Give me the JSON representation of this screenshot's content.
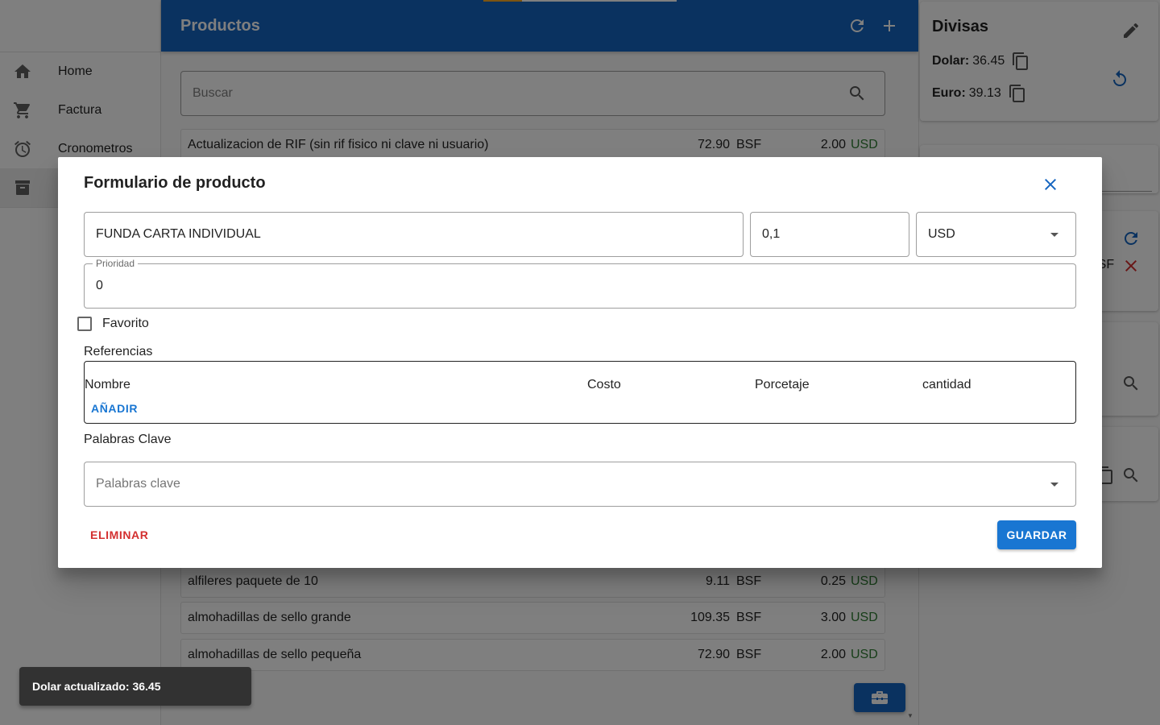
{
  "sidebar": {
    "items": [
      {
        "label": "Home",
        "icon": "home-icon"
      },
      {
        "label": "Factura",
        "icon": "cart-icon"
      },
      {
        "label": "Cronometros",
        "icon": "alarm-icon"
      },
      {
        "label": "",
        "icon": "archive-icon"
      }
    ]
  },
  "appbar": {
    "title": "Productos",
    "icons": [
      "refresh-icon",
      "add-icon"
    ]
  },
  "search": {
    "placeholder": "Buscar"
  },
  "products": [
    {
      "name": "Actualizacion de RIF (sin rif fisico ni clave ni usuario)",
      "bsf": "72.90",
      "bsf_cur": "BSF",
      "usd": "2.00",
      "usd_cur": "USD"
    },
    {
      "name": "alfileres paquete de 10",
      "bsf": "9.11",
      "bsf_cur": "BSF",
      "usd": "0.25",
      "usd_cur": "USD"
    },
    {
      "name": "almohadillas de sello grande",
      "bsf": "109.35",
      "bsf_cur": "BSF",
      "usd": "3.00",
      "usd_cur": "USD"
    },
    {
      "name": "almohadillas de sello pequeña",
      "bsf": "72.90",
      "bsf_cur": "BSF",
      "usd": "2.00",
      "usd_cur": "USD"
    }
  ],
  "divisas": {
    "title": "Divisas",
    "dolar_label": "Dolar:",
    "dolar_value": "36.45",
    "euro_label": "Euro:",
    "euro_value": "39.13"
  },
  "right_partial": {
    "bsf_fragment": "BSF"
  },
  "dialog": {
    "title": "Formulario de producto",
    "name_value": "FUNDA CARTA INDIVIDUAL",
    "price_value": "0,1",
    "currency_value": "USD",
    "priority_label": "Prioridad",
    "priority_value": "0",
    "favorite_label": "Favorito",
    "favorite_checked": false,
    "references_label": "Referencias",
    "ref_columns": [
      "Nombre",
      "Costo",
      "Porcetaje",
      "cantidad"
    ],
    "add_label": "AÑADIR",
    "keywords_label": "Palabras Clave",
    "keywords_placeholder": "Palabras clave",
    "delete_label": "ELIMINAR",
    "save_label": "GUARDAR"
  },
  "snackbar": {
    "text": "Dolar actualizado: 36.45"
  },
  "colors": {
    "primary": "#1565c0",
    "accent": "#1976d2",
    "danger": "#d32f2f",
    "usd": "#2e7d32",
    "progress": "#f9a825"
  }
}
